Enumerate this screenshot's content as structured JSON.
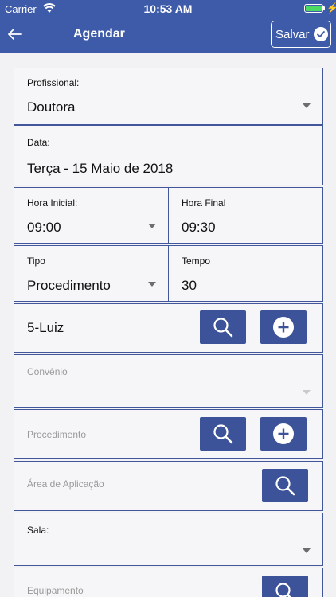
{
  "status_bar": {
    "carrier": "Carrier",
    "time": "10:53 AM"
  },
  "header": {
    "title": "Agendar",
    "save_label": "Salvar"
  },
  "form": {
    "profissional": {
      "label": "Profissional:",
      "value": "Doutora"
    },
    "data": {
      "label": "Data:",
      "value": "Terça - 15 Maio de 2018"
    },
    "hora_inicial": {
      "label": "Hora Inicial:",
      "value": "09:00"
    },
    "hora_final": {
      "label": "Hora Final",
      "value": "09:30"
    },
    "tipo": {
      "label": "Tipo",
      "value": "Procedimento"
    },
    "tempo": {
      "label": "Tempo",
      "value": "30"
    },
    "paciente": {
      "value": "5-Luiz"
    },
    "convenio": {
      "label": "Convênio"
    },
    "procedimento": {
      "label": "Procedimento"
    },
    "area_aplicacao": {
      "label": "Área de Aplicação"
    },
    "sala": {
      "label": "Sala:"
    },
    "equipamento": {
      "label": "Equipamento"
    }
  }
}
